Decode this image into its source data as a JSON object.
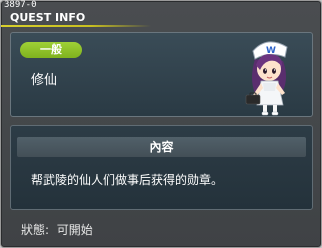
{
  "quest_id": "3897-0",
  "window_title": "QUEST INFO",
  "category": "一般",
  "quest_name": "修仙",
  "description_header": "內容",
  "description": "帮武陵的仙人们做事后获得的勋章。",
  "status_label": "狀態",
  "status_value": "可開始",
  "icons": {
    "npc": "nurse-npc-character-icon"
  },
  "colors": {
    "window_bg": "#45484b",
    "title_line": "#d9d02c",
    "badge_green": "#8cc128",
    "panel_top": "#34454f",
    "panel_desc": "#2a3841"
  }
}
